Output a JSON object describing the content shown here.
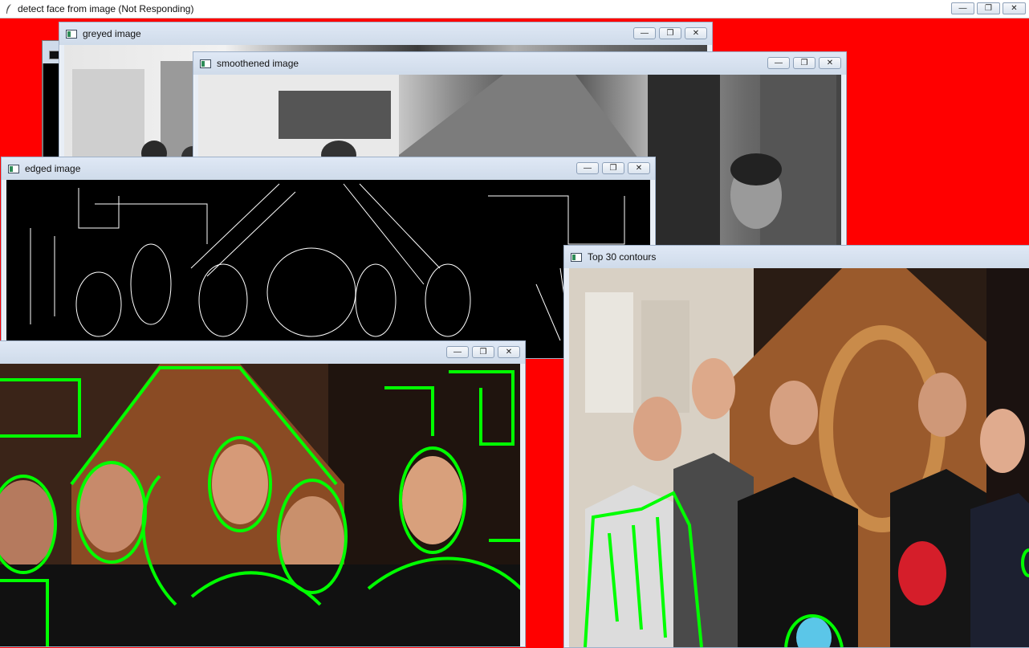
{
  "main_window": {
    "title": "detect face from image (Not Responding)",
    "icon": "feather-icon"
  },
  "windows": {
    "greyed": {
      "title": "greyed image"
    },
    "smoothened": {
      "title": "smoothened image"
    },
    "edged": {
      "title": "edged image"
    },
    "contours_all": {
      "title": ""
    },
    "top30": {
      "title": "Top 30 contours"
    }
  },
  "controls": {
    "minimize": "—",
    "restore": "❐",
    "close": "✕"
  },
  "colors": {
    "desktop_background": "#ff0000",
    "contour_color": "#00ff00"
  }
}
